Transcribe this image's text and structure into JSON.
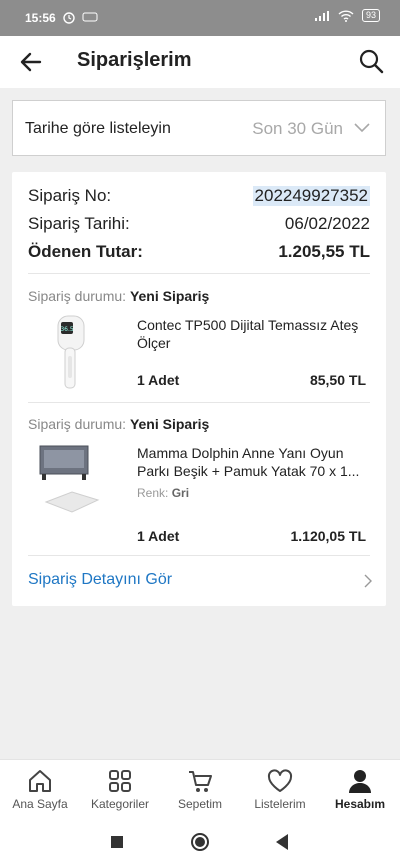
{
  "status_bar": {
    "time": "15:56",
    "battery": "93"
  },
  "header": {
    "title": "Siparişlerim"
  },
  "filter": {
    "label": "Tarihe göre listeleyin",
    "selected": "Son 30 Gün"
  },
  "order": {
    "order_no_label": "Sipariş No:",
    "order_no": "202249927352",
    "date_label": "Sipariş Tarihi:",
    "date": "06/02/2022",
    "total_label": "Ödenen Tutar:",
    "total": "1.205,55 TL",
    "items": [
      {
        "status_label": "Sipariş durumu:",
        "status": "Yeni Sipariş",
        "name": "Contec TP500 Dijital Temassız Ateş Ölçer",
        "quantity": "1 Adet",
        "price": "85,50 TL"
      },
      {
        "status_label": "Sipariş durumu:",
        "status": "Yeni Sipariş",
        "name": "Mamma Dolphin Anne Yanı Oyun Parkı Beşik + Pamuk Yatak 70 x 1...",
        "variant_label": "Renk:",
        "variant_value": "Gri",
        "quantity": "1 Adet",
        "price": "1.120,05 TL"
      }
    ],
    "detail_link": "Sipariş Detayını Gör"
  },
  "tabs": [
    {
      "label": "Ana Sayfa",
      "icon": "home-icon"
    },
    {
      "label": "Kategoriler",
      "icon": "grid-icon"
    },
    {
      "label": "Sepetim",
      "icon": "cart-icon"
    },
    {
      "label": "Listelerim",
      "icon": "heart-icon"
    },
    {
      "label": "Hesabım",
      "icon": "user-icon",
      "active": true
    }
  ],
  "colors": {
    "link": "#1f77c4",
    "order_no_highlight": "#dbe9f7"
  }
}
